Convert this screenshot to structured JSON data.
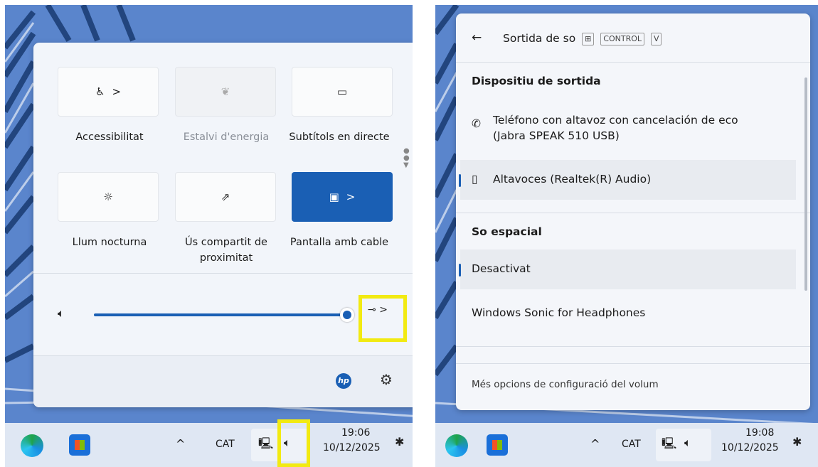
{
  "left": {
    "tiles": [
      {
        "label": "Accessibilitat",
        "icon": "accessibility-icon",
        "chevron": ">"
      },
      {
        "label": "Estalvi d'energia",
        "icon": "energy-saver-icon"
      },
      {
        "label": "Subtítols en directe",
        "icon": "captions-icon"
      },
      {
        "label": "Llum nocturna",
        "icon": "night-light-icon"
      },
      {
        "label": "Ús compartit de proximitat",
        "icon": "nearby-share-icon"
      },
      {
        "label": "Pantalla amb cable",
        "icon": "cast-icon",
        "chevron": ">"
      }
    ],
    "volume": {
      "level": 1.0,
      "speaker_icon": "speaker-icon",
      "output_icon": "sound-output-icon",
      "chevron": ">"
    },
    "footer": {
      "brand_icon": "hp-logo-icon",
      "settings_icon": "gear-icon"
    }
  },
  "taskbar_left": {
    "language": "CAT",
    "time": "19:06",
    "date": "10/12/2025"
  },
  "right": {
    "header": {
      "back_icon": "arrow-left-icon",
      "title": "Sortida de so",
      "key1": "⊞",
      "key2": "CONTROL",
      "key3": "V"
    },
    "section_output": "Dispositiu de sortida",
    "devices": [
      {
        "name": "Teléfono con altavoz con cancelación de eco",
        "sub": "(Jabra SPEAK 510 USB)",
        "icon": "phone-icon",
        "selected": false
      },
      {
        "name": "Altavoces (Realtek(R) Audio)",
        "icon": "speaker-device-icon",
        "selected": true
      }
    ],
    "section_spatial": "So espacial",
    "spatial": [
      {
        "name": "Desactivat",
        "selected": true
      },
      {
        "name": "Windows Sonic for Headphones",
        "selected": false
      }
    ],
    "more_link": "Més opcions de configuració del volum"
  },
  "taskbar_right": {
    "language": "CAT",
    "time": "19:08",
    "date": "10/12/2025"
  },
  "colors": {
    "accent": "#1a5fb4",
    "highlight": "#f2ea12"
  }
}
